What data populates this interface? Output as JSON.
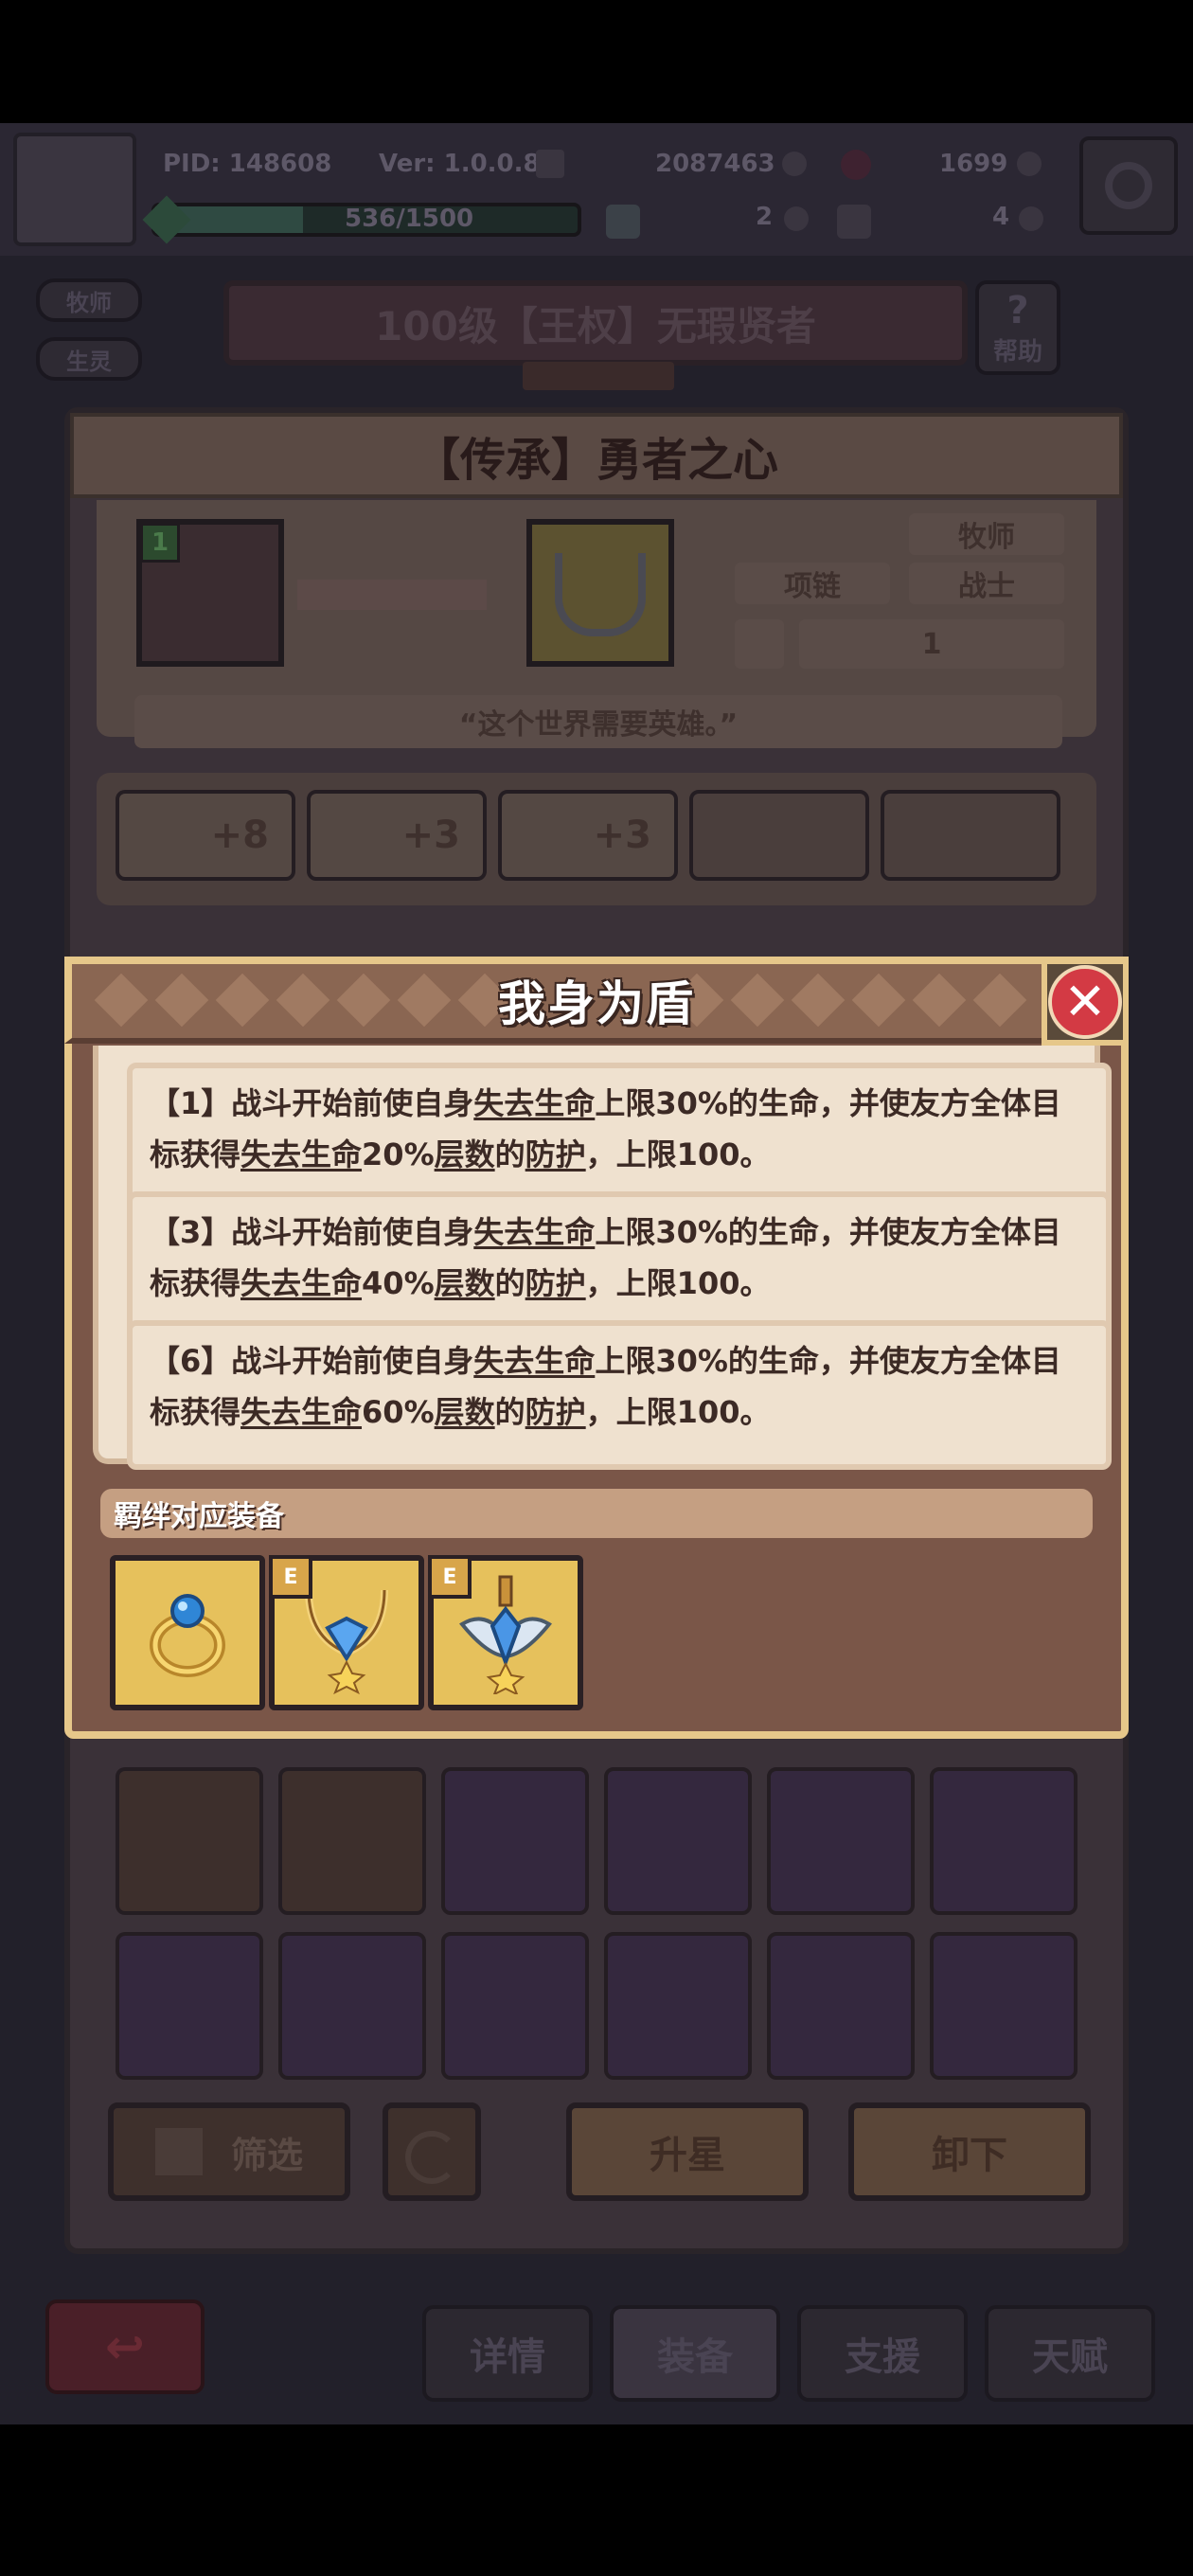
{
  "hud": {
    "pid": "PID: 148608",
    "version": "Ver: 1.0.0.8",
    "gold": "2087463",
    "gems": "1699",
    "exp": "536/1500",
    "currency_a": "2",
    "currency_b": "4"
  },
  "side_tabs": [
    "牧师",
    "生灵"
  ],
  "hero_title": "100级【王权】无瑕贤者",
  "help_label": "帮助",
  "item": {
    "title": "【传承】勇者之心",
    "type": "项链",
    "class_a": "牧师",
    "class_b": "战士",
    "count": "1",
    "quote": "“这个世界需要英雄。”",
    "hero_level_badge": "1",
    "stats": [
      "+8",
      "+3",
      "+3"
    ]
  },
  "modal": {
    "title": "我身为盾",
    "effects": [
      {
        "tier": "【1】",
        "pre": "战斗开始前使自身",
        "k1": "失去生命",
        "mid1": "上限30%的生命，并使友方全体目标获得",
        "k2": "失去生命",
        "mid2": "20%",
        "k3": "层数",
        "mid3": "的",
        "k4": "防护",
        "post": "，上限100。"
      },
      {
        "tier": "【3】",
        "pre": "战斗开始前使自身",
        "k1": "失去生命",
        "mid1": "上限30%的生命，并使友方全体目标获得",
        "k2": "失去生命",
        "mid2": "40%",
        "k3": "层数",
        "mid3": "的",
        "k4": "防护",
        "post": "，上限100。"
      },
      {
        "tier": "【6】",
        "pre": "战斗开始前使自身",
        "k1": "失去生命",
        "mid1": "上限30%的生命，并使友方全体目标获得",
        "k2": "失去生命",
        "mid2": "60%",
        "k3": "层数",
        "mid3": "的",
        "k4": "防护",
        "post": "，上限100。"
      }
    ],
    "bond_header": "羁绊对应装备",
    "bond_items": [
      {
        "icon": "ring-icon",
        "badge": ""
      },
      {
        "icon": "necklace-icon",
        "badge": "E"
      },
      {
        "icon": "sword-amulet-icon",
        "badge": "E"
      }
    ]
  },
  "actions": {
    "filter": "筛选",
    "upgrade": "升星",
    "unequip": "卸下"
  },
  "bottom_tabs": [
    "详情",
    "装备",
    "支援",
    "天赋"
  ],
  "colors": {
    "modal_border": "#e6c78a",
    "modal_bg": "#7a5648",
    "effect_bg": "#efe1cf",
    "close_red": "#d33a44"
  }
}
